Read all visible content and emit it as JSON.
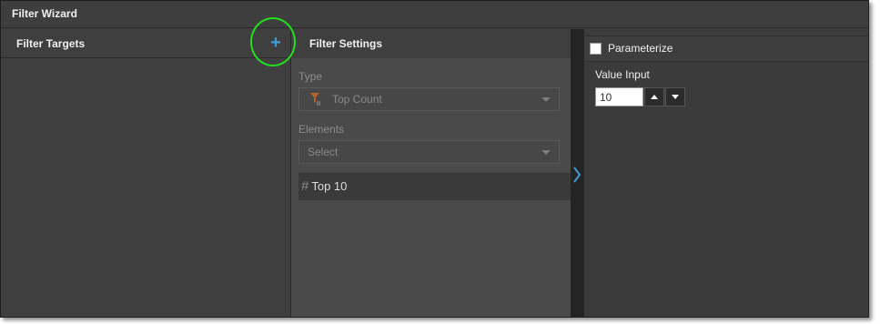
{
  "window": {
    "title": "Filter Wizard"
  },
  "targets": {
    "header": "Filter Targets",
    "add_symbol": "+",
    "add_icon": "plus-icon"
  },
  "settings": {
    "header": "Filter Settings",
    "type_label": "Type",
    "type_value": "Top Count",
    "elements_label": "Elements",
    "elements_placeholder": "Select",
    "list_items": [
      {
        "icon": "#",
        "label": "Top 10"
      }
    ]
  },
  "parameters": {
    "parameterize_label": "Parameterize",
    "parameterize_checked": false,
    "value_input_label": "Value Input",
    "value": "10"
  },
  "colors": {
    "accent": "#3e9ad8",
    "highlight": "#22e01c",
    "panel": "#3f3f3f"
  }
}
